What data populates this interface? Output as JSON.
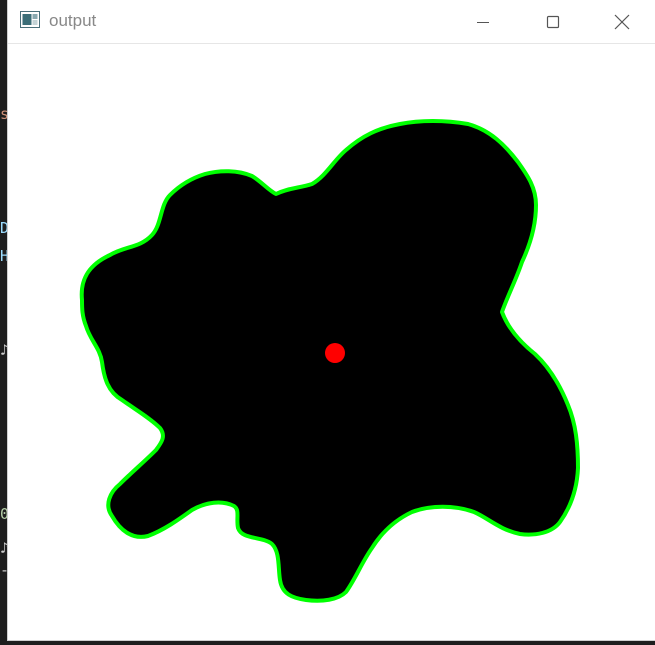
{
  "window": {
    "title": "output",
    "icon": "image-window-icon",
    "controls": {
      "minimize_icon": "minimize-icon",
      "maximize_icon": "maximize-icon",
      "close_icon": "close-icon"
    }
  },
  "canvas": {
    "background": "#ffffff",
    "blob_fill": "#000000",
    "contour_color": "#00ff00",
    "center_marker_color": "#ff0000"
  },
  "backdrop_glyphs": [
    {
      "text": "s",
      "color": "#ce9178"
    },
    {
      "text": "D",
      "color": "#9cdcfe"
    },
    {
      "text": "H",
      "color": "#9cdcfe"
    },
    {
      "text": "♪",
      "color": "#cccccc"
    },
    {
      "text": "0",
      "color": "#b5cea8"
    },
    {
      "text": "♪",
      "color": "#cccccc"
    },
    {
      "text": "-",
      "color": "#cccccc"
    }
  ]
}
